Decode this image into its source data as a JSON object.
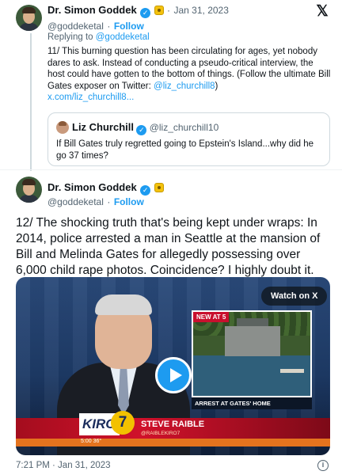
{
  "tweet1": {
    "author_name": "Dr. Simon Goddek",
    "handle": "@goddeketal",
    "separator": "·",
    "follow_label": "Follow",
    "date": "Jan 31, 2023",
    "replying_prefix": "Replying to",
    "replying_to": "@goddeketal",
    "body_text": "11/ This burning question has been circulating for ages, yet nobody dares to ask. Instead of conducting a pseudo-critical interview, the host could have gotten to the bottom of things. (Follow the ultimate Bill Gates exposer on Twitter: ",
    "body_mention": "@liz_churchill8",
    "body_close": ")",
    "body_link": "x.com/liz_churchill8...",
    "quote": {
      "author_name": "Liz Churchill",
      "handle": "@liz_churchill10",
      "text": "If Bill Gates truly regretted going to Epstein's Island...why did he go 37 times?"
    }
  },
  "tweet2": {
    "author_name": "Dr. Simon Goddek",
    "handle": "@goddeketal",
    "separator": "·",
    "follow_label": "Follow",
    "body_text": "12/ The shocking truth that's being kept under wraps: In 2014, police arrested a man in Seattle at the mansion of Bill and Melinda Gates for allegedly possessing over 6,000 child rape photos. Coincidence? I highly doubt it.",
    "video": {
      "watch_label": "Watch on X",
      "new_at_label": "NEW AT 5",
      "inset_caption": "ARREST AT GATES' HOME",
      "station_text": "KIRO",
      "station_number": "7",
      "reporter_name": "STEVE RAIBLE",
      "reporter_handle": "@RAIBLEKIRO7",
      "time": "5:00",
      "temp": "36°"
    },
    "timestamp": "7:21 PM · Jan 31, 2023",
    "info_icon_label": "i"
  },
  "icons": {
    "x_logo": "x-logo-icon",
    "verified": "verified-badge-icon",
    "gold": "gold-badge-icon",
    "play": "play-icon",
    "info": "info-icon"
  },
  "colors": {
    "accent": "#1d9bf0",
    "text_primary": "#0f1419",
    "text_secondary": "#536471",
    "border": "#cfd9de",
    "news_red": "#c8102e"
  }
}
